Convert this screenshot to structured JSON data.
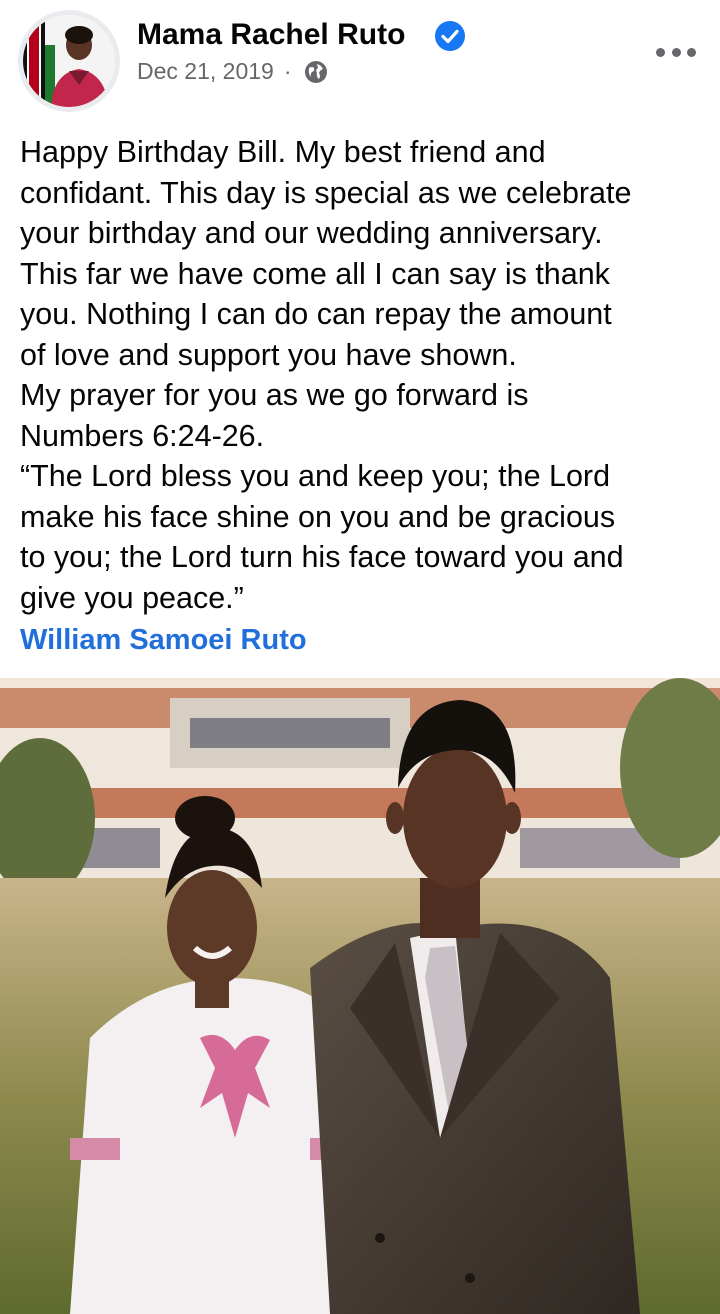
{
  "post": {
    "author": "Mama Rachel Ruto",
    "date": "Dec 21, 2019",
    "separator": "·",
    "verified": true,
    "privacy_icon": "globe-icon",
    "more_icon": "more-options-icon",
    "text_lines": [
      "Happy Birthday Bill. My best friend and",
      "confidant. This day is special as we celebrate",
      "your birthday and our wedding anniversary.",
      "This far we have come all I can say is thank",
      "you. Nothing I can do can repay the amount",
      "of love and support you have shown.",
      "My prayer for you as we go forward is",
      "Numbers 6:24-26.",
      "“The Lord bless you and keep you; the Lord",
      "make his face shine on you and be gracious",
      "to you; the Lord turn his face toward you and",
      "give you peace.”"
    ],
    "tagged_person": "William Samoei Ruto"
  },
  "colors": {
    "link": "#216fdb",
    "verified": "#1877f2",
    "meta_text": "#65676b"
  }
}
